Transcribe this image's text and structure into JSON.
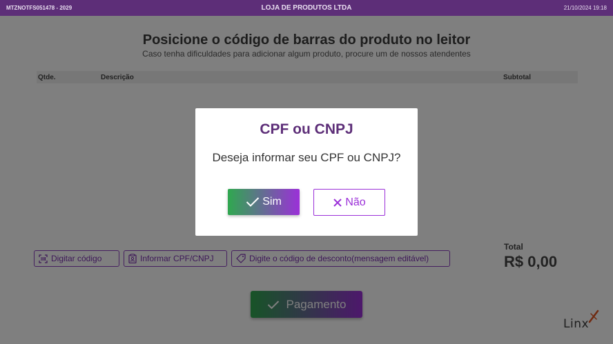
{
  "topbar": {
    "terminal": "MTZNOTFS051478 - 2029",
    "store": "LOJA DE PRODUTOS LTDA",
    "datetime": "21/10/2024 19:18"
  },
  "main": {
    "headline": "Posicione o código de barras do produto no leitor",
    "subline": "Caso tenha dificuldades para adicionar algum produto, procure um de nossos atendentes"
  },
  "table": {
    "columns": [
      "Qtde.",
      "Descrição",
      "Subtotal"
    ]
  },
  "actions": {
    "type_code": "Digitar código",
    "inform_cpf": "Informar CPF/CNPJ",
    "discount": "Digite o código de desconto(mensagem editável)"
  },
  "total": {
    "label": "Total",
    "value": "R$ 0,00"
  },
  "payment": {
    "label": "Pagamento"
  },
  "logo": {
    "text": "Linx"
  },
  "modal": {
    "title": "CPF ou CNPJ",
    "message": "Deseja informar seu CPF ou CNPJ?",
    "yes_label": "Sim",
    "no_label": "Não"
  },
  "colors": {
    "brand": "#5d2e78",
    "accent": "#9b30d8",
    "green": "#2fa84f"
  }
}
